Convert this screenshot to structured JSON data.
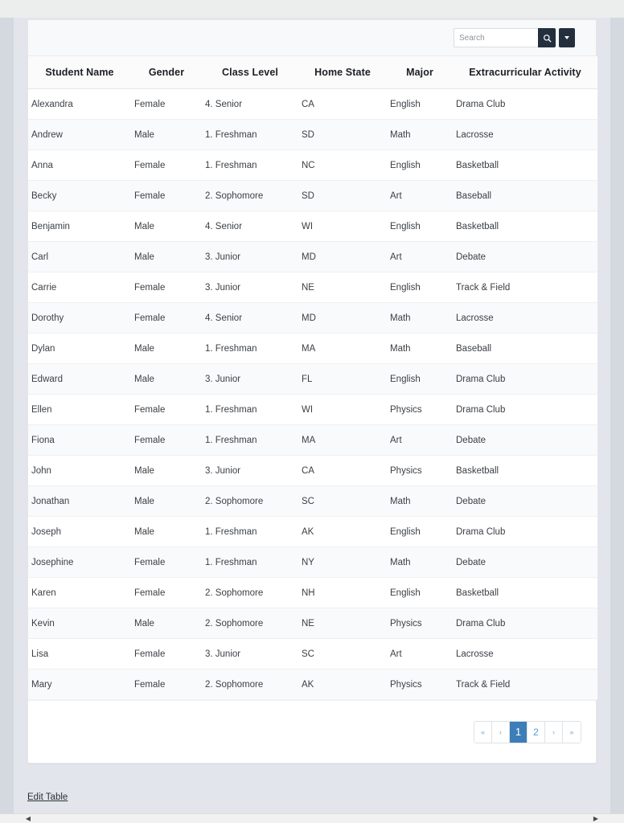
{
  "search": {
    "placeholder": "Search",
    "value": "",
    "search_icon": "search-icon",
    "dropdown_icon": "chevron-down-icon"
  },
  "table": {
    "columns": [
      "Student Name",
      "Gender",
      "Class Level",
      "Home State",
      "Major",
      "Extracurricular Activity"
    ],
    "rows": [
      {
        "name": "Alexandra",
        "gender": "Female",
        "class_level": "4. Senior",
        "home_state": "CA",
        "major": "English",
        "activity": "Drama Club"
      },
      {
        "name": "Andrew",
        "gender": "Male",
        "class_level": "1. Freshman",
        "home_state": "SD",
        "major": "Math",
        "activity": "Lacrosse"
      },
      {
        "name": "Anna",
        "gender": "Female",
        "class_level": "1. Freshman",
        "home_state": "NC",
        "major": "English",
        "activity": "Basketball"
      },
      {
        "name": "Becky",
        "gender": "Female",
        "class_level": "2. Sophomore",
        "home_state": "SD",
        "major": "Art",
        "activity": "Baseball"
      },
      {
        "name": "Benjamin",
        "gender": "Male",
        "class_level": "4. Senior",
        "home_state": "WI",
        "major": "English",
        "activity": "Basketball"
      },
      {
        "name": "Carl",
        "gender": "Male",
        "class_level": "3. Junior",
        "home_state": "MD",
        "major": "Art",
        "activity": "Debate"
      },
      {
        "name": "Carrie",
        "gender": "Female",
        "class_level": "3. Junior",
        "home_state": "NE",
        "major": "English",
        "activity": "Track & Field"
      },
      {
        "name": "Dorothy",
        "gender": "Female",
        "class_level": "4. Senior",
        "home_state": "MD",
        "major": "Math",
        "activity": "Lacrosse"
      },
      {
        "name": "Dylan",
        "gender": "Male",
        "class_level": "1. Freshman",
        "home_state": "MA",
        "major": "Math",
        "activity": "Baseball"
      },
      {
        "name": "Edward",
        "gender": "Male",
        "class_level": "3. Junior",
        "home_state": "FL",
        "major": "English",
        "activity": "Drama Club"
      },
      {
        "name": "Ellen",
        "gender": "Female",
        "class_level": "1. Freshman",
        "home_state": "WI",
        "major": "Physics",
        "activity": "Drama Club"
      },
      {
        "name": "Fiona",
        "gender": "Female",
        "class_level": "1. Freshman",
        "home_state": "MA",
        "major": "Art",
        "activity": "Debate"
      },
      {
        "name": "John",
        "gender": "Male",
        "class_level": "3. Junior",
        "home_state": "CA",
        "major": "Physics",
        "activity": "Basketball"
      },
      {
        "name": "Jonathan",
        "gender": "Male",
        "class_level": "2. Sophomore",
        "home_state": "SC",
        "major": "Math",
        "activity": "Debate"
      },
      {
        "name": "Joseph",
        "gender": "Male",
        "class_level": "1. Freshman",
        "home_state": "AK",
        "major": "English",
        "activity": "Drama Club"
      },
      {
        "name": "Josephine",
        "gender": "Female",
        "class_level": "1. Freshman",
        "home_state": "NY",
        "major": "Math",
        "activity": "Debate"
      },
      {
        "name": "Karen",
        "gender": "Female",
        "class_level": "2. Sophomore",
        "home_state": "NH",
        "major": "English",
        "activity": "Basketball"
      },
      {
        "name": "Kevin",
        "gender": "Male",
        "class_level": "2. Sophomore",
        "home_state": "NE",
        "major": "Physics",
        "activity": "Drama Club"
      },
      {
        "name": "Lisa",
        "gender": "Female",
        "class_level": "3. Junior",
        "home_state": "SC",
        "major": "Art",
        "activity": "Lacrosse"
      },
      {
        "name": "Mary",
        "gender": "Female",
        "class_level": "2. Sophomore",
        "home_state": "AK",
        "major": "Physics",
        "activity": "Track & Field"
      }
    ]
  },
  "pagination": {
    "items": [
      {
        "label": "«",
        "type": "arrow",
        "name": "pagination-first",
        "active": false
      },
      {
        "label": "‹",
        "type": "arrow",
        "name": "pagination-prev",
        "active": false
      },
      {
        "label": "1",
        "type": "page",
        "name": "pagination-page-1",
        "active": true
      },
      {
        "label": "2",
        "type": "page",
        "name": "pagination-page-2",
        "active": false
      },
      {
        "label": "›",
        "type": "arrow",
        "name": "pagination-next",
        "active": false
      },
      {
        "label": "»",
        "type": "arrow",
        "name": "pagination-last",
        "active": false
      }
    ]
  },
  "footer": {
    "edit_table_label": "Edit Table"
  },
  "colors": {
    "accent_blue": "#3d7eb8",
    "link_blue": "#5b9bd5",
    "highlight_red": "#ff4444",
    "dark_button": "#242f3e",
    "page_background": "#e2e6ec"
  }
}
